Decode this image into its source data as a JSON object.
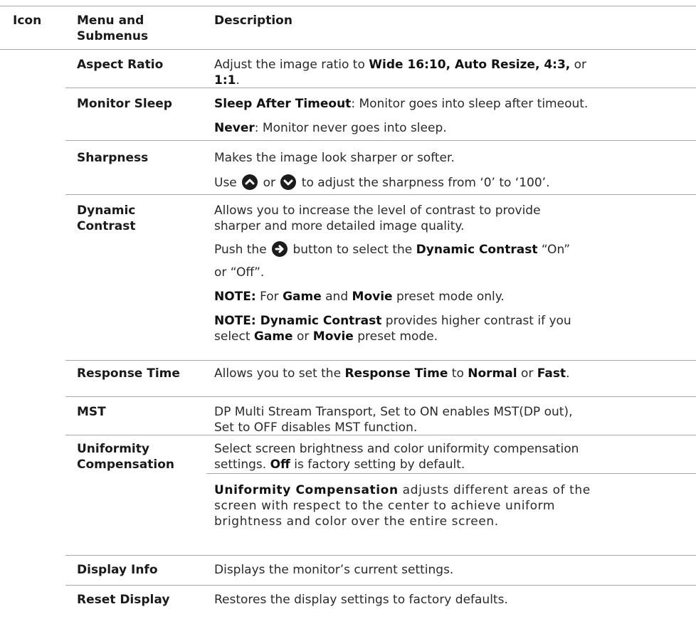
{
  "header": {
    "icon": "Icon",
    "menu_line1": "Menu and",
    "menu_line2": "Submenus",
    "description": "Description"
  },
  "rows": {
    "aspect_ratio": {
      "label": "Aspect Ratio",
      "d1": "Adjust the image ratio to ",
      "b1": "Wide 16:10, Auto Resize, 4:3,",
      "d2": " or",
      "b2": "1:1",
      "d3": "."
    },
    "monitor_sleep": {
      "label": "Monitor Sleep",
      "b1": "Sleep After Timeout",
      "d1": ": Monitor goes into sleep after timeout.",
      "b2": "Never",
      "d2": ": Monitor never goes into sleep."
    },
    "sharpness": {
      "label": "Sharpness",
      "d1": "Makes the image look sharper or softer.",
      "d2": "Use ",
      "d3": " or ",
      "d4": " to adjust the sharpness from ‘0’ to ‘100’."
    },
    "dynamic_contrast": {
      "label_line1": "Dynamic",
      "label_line2": "Contrast",
      "d1a": "Allows you to increase the level of contrast to provide",
      "d1b": "sharper and more detailed image quality.",
      "d2a": "Push the ",
      "d2b": " button to select the ",
      "b2": "Dynamic Contrast",
      "d2c": " “On”",
      "d3": "or “Off”.",
      "n1_label": "NOTE:",
      "n1_a": " For ",
      "n1_game": "Game",
      "n1_b": " and ",
      "n1_movie": "Movie",
      "n1_c": " preset mode only.",
      "n2_label": "NOTE:",
      "n2_bold": " Dynamic Contrast",
      "n2_a": " provides higher contrast if you",
      "n2_b": "select ",
      "n2_game": "Game",
      "n2_c": " or ",
      "n2_movie": "Movie",
      "n2_d": " preset mode."
    },
    "response_time": {
      "label": "Response Time",
      "d1": "Allows you to set the ",
      "b1": "Response Time",
      "d2": " to ",
      "b2": "Normal",
      "d3": " or ",
      "b3": "Fast",
      "d4": "."
    },
    "mst": {
      "label": "MST",
      "d1": "DP Multi Stream Transport,  Set to ON enables MST(DP out),",
      "d2": "Set to OFF disables MST function."
    },
    "uniformity": {
      "label_line1": "Uniformity",
      "label_line2": "Compensation",
      "d1": "Select screen brightness and color uniformity compensation",
      "d2a": "settings. ",
      "b2": "Off",
      "d2b": " is factory setting by default.",
      "b3": "Uniformity Compensation",
      "d3": " adjusts different areas of the",
      "d4": "screen with respect to the center to achieve uniform",
      "d5": "brightness and color over the entire screen."
    },
    "display_info": {
      "label": "Display Info",
      "d1": "Displays the monitor’s current settings."
    },
    "reset_display": {
      "label": "Reset Display",
      "d1": "Restores the display settings to factory defaults."
    }
  },
  "icons": [
    "up-circle-icon",
    "down-circle-icon",
    "right-arrow-circle-icon"
  ]
}
